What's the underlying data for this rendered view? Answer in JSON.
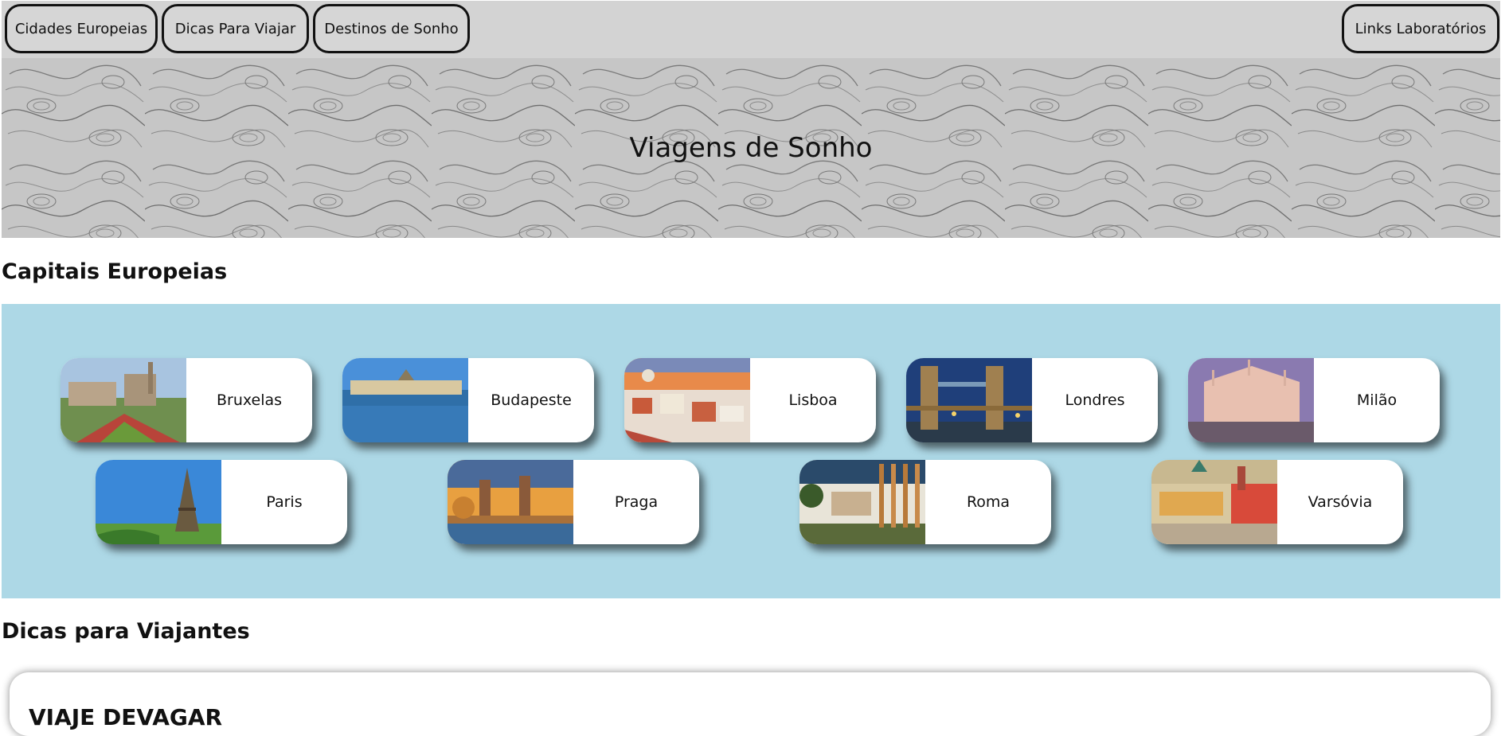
{
  "nav": {
    "items": [
      {
        "label": "Cidades Europeias"
      },
      {
        "label": "Dicas Para Viajar"
      },
      {
        "label": "Destinos de Sonho"
      }
    ],
    "right_item": {
      "label": "Links Laboratórios"
    }
  },
  "banner": {
    "title": "Viagens de Sonho"
  },
  "capitals": {
    "heading": "Capitais Europeias",
    "cities": [
      {
        "name": "Bruxelas"
      },
      {
        "name": "Budapeste"
      },
      {
        "name": "Lisboa"
      },
      {
        "name": "Londres"
      },
      {
        "name": "Milão"
      },
      {
        "name": "Paris"
      },
      {
        "name": "Praga"
      },
      {
        "name": "Roma"
      },
      {
        "name": "Varsóvia"
      }
    ]
  },
  "tips": {
    "heading": "Dicas para Viajantes",
    "first_title": "VIAJE DEVAGAR"
  },
  "colors": {
    "nav_bg": "#d3d3d3",
    "capitals_bg": "#add8e6",
    "banner_bg": "#c4c4c4"
  }
}
